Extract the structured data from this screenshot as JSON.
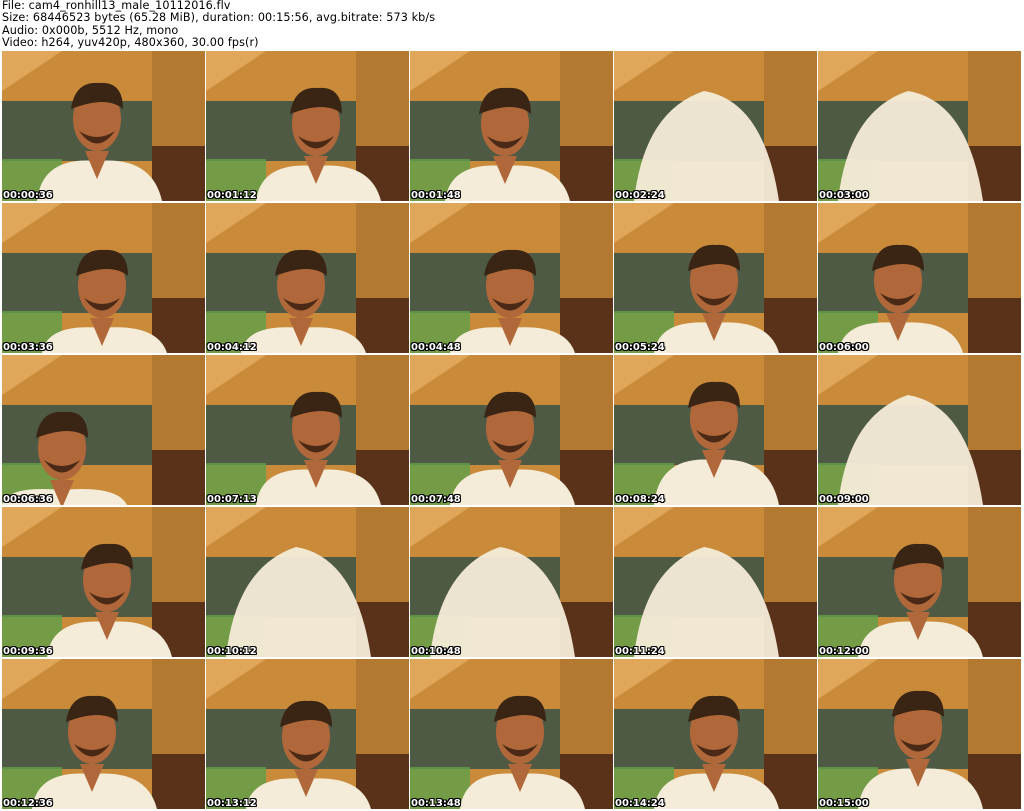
{
  "info": {
    "file": "File: cam4_ronhill13_male_10112016.flv",
    "size": "Size: 68446523 bytes (65.28 MiB), duration: 00:15:56, avg.bitrate: 573 kb/s",
    "audio": "Audio: 0x000b, 5512 Hz, mono",
    "video": "Video: h264, yuv420p, 480x360, 30.00 fps(r)"
  },
  "thumbnails": [
    {
      "timestamp": "00:00:36"
    },
    {
      "timestamp": "00:01:12"
    },
    {
      "timestamp": "00:01:48"
    },
    {
      "timestamp": "00:02:24"
    },
    {
      "timestamp": "00:03:00"
    },
    {
      "timestamp": "00:03:36"
    },
    {
      "timestamp": "00:04:12"
    },
    {
      "timestamp": "00:04:48"
    },
    {
      "timestamp": "00:05:24"
    },
    {
      "timestamp": "00:06:00"
    },
    {
      "timestamp": "00:06:36"
    },
    {
      "timestamp": "00:07:13"
    },
    {
      "timestamp": "00:07:48"
    },
    {
      "timestamp": "00:08:24"
    },
    {
      "timestamp": "00:09:00"
    },
    {
      "timestamp": "00:09:36"
    },
    {
      "timestamp": "00:10:12"
    },
    {
      "timestamp": "00:10:48"
    },
    {
      "timestamp": "00:11:24"
    },
    {
      "timestamp": "00:12:00"
    },
    {
      "timestamp": "00:12:36"
    },
    {
      "timestamp": "00:13:12"
    },
    {
      "timestamp": "00:13:48"
    },
    {
      "timestamp": "00:14:24"
    },
    {
      "timestamp": "00:15:00"
    }
  ],
  "colors": {
    "wall": "#c98a3a",
    "wall_dark": "#8a5a22",
    "window": "#4f5a45",
    "shirt": "#f4ecd8",
    "skin": "#b0683a",
    "hair": "#3a2414",
    "chair": "#5a321a",
    "aquarium": "#5fa04a"
  }
}
